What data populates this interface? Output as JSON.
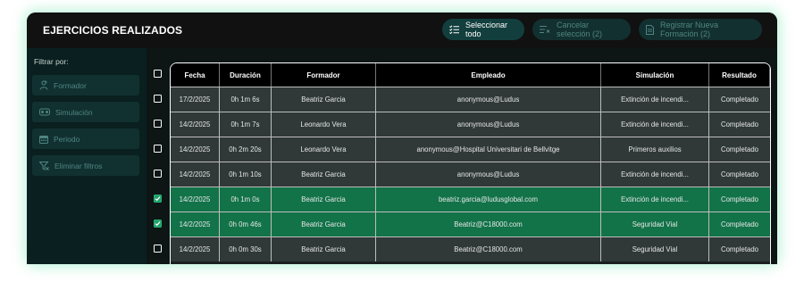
{
  "header": {
    "title": "EJERCICIOS REALIZADOS",
    "select_all": "Seleccionar todo",
    "cancel_selection": "Cancelar selección (2)",
    "register_training": "Registrar Nueva Formación (2)"
  },
  "sidebar": {
    "filter_label": "Filtrar por:",
    "items": [
      {
        "label": "Formador",
        "icon": "trainer-icon"
      },
      {
        "label": "Simulación",
        "icon": "vr-headset-icon"
      },
      {
        "label": "Periodo",
        "icon": "calendar-icon"
      },
      {
        "label": "Eliminar filtros",
        "icon": "clear-filter-icon"
      }
    ]
  },
  "table": {
    "columns": [
      "Fecha",
      "Duración",
      "Formador",
      "Empleado",
      "Simulación",
      "Resultado"
    ],
    "rows": [
      {
        "checked": false,
        "cells": [
          "17/2/2025",
          "0h 1m 6s",
          "Beatriz Garcia",
          "anonymous@Ludus",
          "Extinción de incendi...",
          "Completado"
        ]
      },
      {
        "checked": false,
        "cells": [
          "14/2/2025",
          "0h 1m 7s",
          "Leonardo Vera",
          "anonymous@Ludus",
          "Extinción de incendi...",
          "Completado"
        ]
      },
      {
        "checked": false,
        "cells": [
          "14/2/2025",
          "0h 2m 20s",
          "Leonardo Vera",
          "anonymous@Hospital Universitari de Bellvitge",
          "Primeros auxilios",
          "Completado"
        ]
      },
      {
        "checked": false,
        "cells": [
          "14/2/2025",
          "0h 1m 10s",
          "Beatriz Garcia",
          "anonymous@Ludus",
          "Extinción de incendi...",
          "Completado"
        ]
      },
      {
        "checked": true,
        "cells": [
          "14/2/2025",
          "0h 1m 0s",
          "Beatriz Garcia",
          "beatriz.garcia@ludusglobal.com",
          "Extinción de incendi...",
          "Completado"
        ]
      },
      {
        "checked": true,
        "cells": [
          "14/2/2025",
          "0h 0m 46s",
          "Beatriz Garcia",
          "Beatriz@C18000.com",
          "Seguridad Vial",
          "Completado"
        ]
      },
      {
        "checked": false,
        "cells": [
          "14/2/2025",
          "0h 0m 30s",
          "Beatriz Garcia",
          "Beatriz@C18000.com",
          "Seguridad Vial",
          "Completado"
        ]
      }
    ]
  },
  "colors": {
    "panel_bg": "#0d1515",
    "header_bg": "#111111",
    "sidebar_bg": "#0a1f1f",
    "row_bg": "#303838",
    "selected_row_bg": "#127348",
    "accent_green": "#27b877"
  }
}
